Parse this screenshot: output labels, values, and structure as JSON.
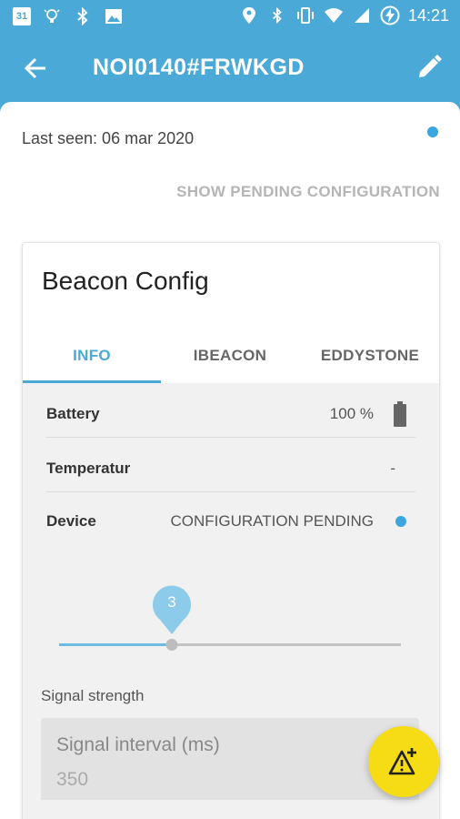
{
  "status_bar": {
    "calendar_day": "31",
    "time": "14:21",
    "left_icons": [
      "calendar-icon",
      "lightbulb-icon",
      "bluetooth-icon",
      "image-icon"
    ],
    "right_icons": [
      "location-icon",
      "bluetooth-icon",
      "vibrate-icon",
      "wifi-icon",
      "cell-signal-icon",
      "battery-charging-icon"
    ]
  },
  "app_bar": {
    "title": "NOI0140#FRWKGD",
    "back_icon": "arrow-back-icon",
    "edit_icon": "pencil-icon"
  },
  "header": {
    "last_seen": "Last seen: 06 mar 2020",
    "pending_link": "SHOW PENDING CONFIGURATION"
  },
  "card": {
    "title": "Beacon Config",
    "tabs": [
      {
        "label": "INFO",
        "active": true
      },
      {
        "label": "IBEACON",
        "active": false
      },
      {
        "label": "EDDYSTONE",
        "active": false
      }
    ],
    "rows": [
      {
        "label": "Battery",
        "value": "100 %"
      },
      {
        "label": "Temperatur",
        "value": "-"
      },
      {
        "label": "Device",
        "value": "CONFIGURATION PENDING"
      }
    ],
    "slider": {
      "value": "3",
      "fraction": 0.33
    },
    "signal_strength_label": "Signal strength",
    "interval": {
      "label": "Signal interval (ms)",
      "value": "350"
    }
  },
  "fab": {
    "icon": "warning-add-icon"
  },
  "colors": {
    "primary": "#4aa9d6",
    "accent_fab": "#f6dc14",
    "status_dot": "#3aa6dd"
  }
}
